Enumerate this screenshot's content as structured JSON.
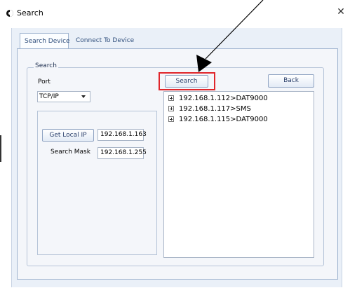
{
  "window": {
    "title": "Search",
    "close_glyph": "✕"
  },
  "tabs": [
    {
      "label": "Search Device",
      "active": true
    },
    {
      "label": "Connect To Device",
      "active": false
    }
  ],
  "search_group": {
    "legend": "Search",
    "port_label": "Port",
    "port_value": "TCP/IP",
    "get_local_ip_label": "Get Local IP",
    "local_ip_value": "192.168.1.163",
    "search_mask_label": "Search Mask",
    "search_mask_value": "192.168.1.255",
    "search_button_label": "Search",
    "back_button_label": "Back"
  },
  "results": [
    {
      "text": "192.168.1.112>DAT9000"
    },
    {
      "text": "192.168.1.117>SMS"
    },
    {
      "text": "192.168.1.115>DAT9000"
    }
  ],
  "colors": {
    "highlight": "#e0262b",
    "arrow": "#000000"
  },
  "icons": {
    "app": "app-logo-icon",
    "close": "close-icon",
    "expand": "plus-box-icon"
  }
}
